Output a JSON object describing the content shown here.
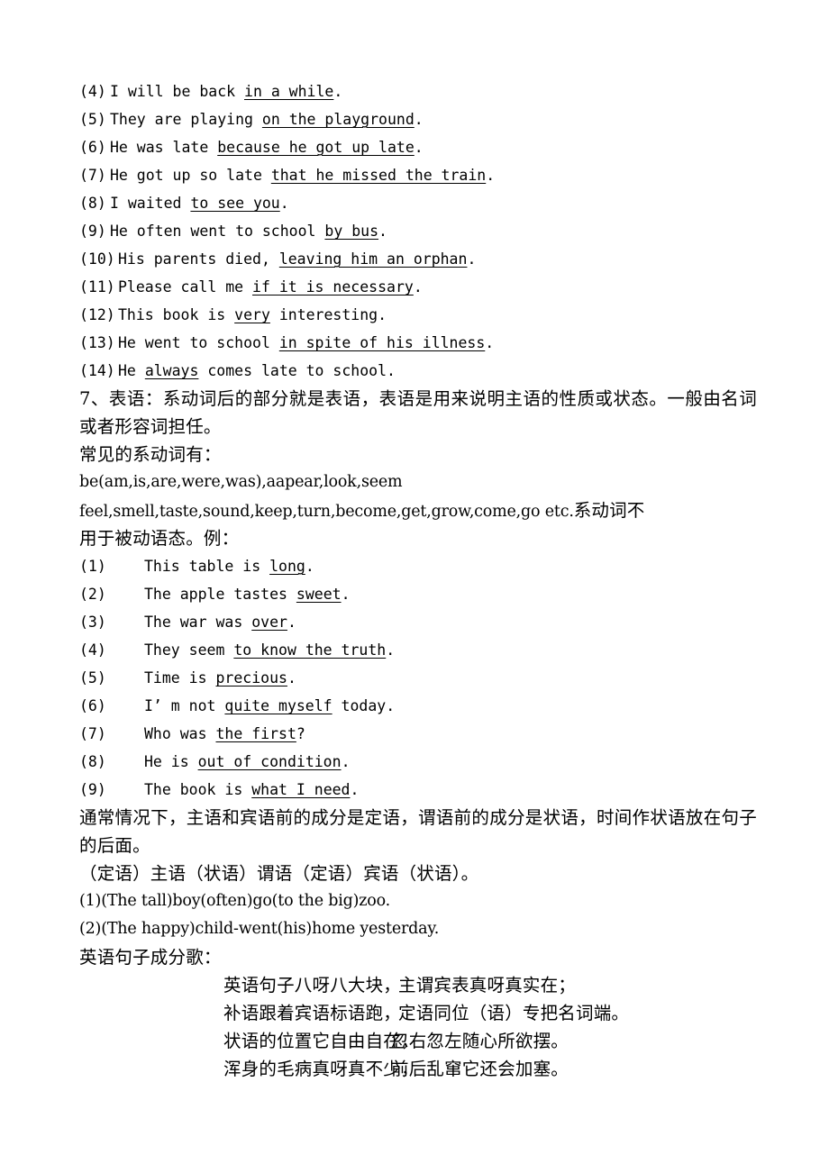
{
  "document": {
    "adverbial_examples": [
      {
        "num": "(4)",
        "width": "w3",
        "pre": "I will be back ",
        "underlined": "in a while",
        "post": "."
      },
      {
        "num": "(5)",
        "width": "w3",
        "pre": "They are playing ",
        "underlined": "on the playground",
        "post": "."
      },
      {
        "num": "(6)",
        "width": "w3",
        "pre": "He was late ",
        "underlined": "because he got up late",
        "post": "."
      },
      {
        "num": "(7)",
        "width": "w3",
        "pre": "He got up so late ",
        "underlined": "that he missed the train",
        "post": "."
      },
      {
        "num": "(8)",
        "width": "w3",
        "pre": "I waited ",
        "underlined": "to see you",
        "post": "."
      },
      {
        "num": "(9)",
        "width": "w3",
        "pre": "He often went to school ",
        "underlined": "by bus",
        "post": "."
      },
      {
        "num": "(10)",
        "width": "w4",
        "pre": "His parents died, ",
        "underlined": "leaving him an orphan",
        "post": "."
      },
      {
        "num": "(11)",
        "width": "w4",
        "pre": "Please call me ",
        "underlined": "if it is necessary",
        "post": "."
      },
      {
        "num": "(12)",
        "width": "w4",
        "pre": "This book is ",
        "underlined": "very",
        "post": " interesting."
      },
      {
        "num": "(13)",
        "width": "w4",
        "pre": "He went to school ",
        "underlined": "in spite of his illness",
        "post": "."
      },
      {
        "num": "(14)",
        "width": "w4",
        "pre": "He ",
        "underlined": "always",
        "post": " comes late to school."
      }
    ],
    "section_7": {
      "heading_paragraph": "7、表语：系动词后的部分就是表语，表语是用来说明主语的性质或状态。一般由名词或者形容词担任。",
      "common_linking_verbs_label": "常见的系动词有：",
      "linking_verbs_line_1": "be(am,is,are,were,was),aapear,look,seem",
      "linking_verbs_line_2_en": "feel,smell,taste,sound,keep,turn,become,get,grow,come,go etc.",
      "linking_verbs_line_2_cn": "系动词不",
      "linking_verbs_line_3_cn": "用于被动语态。例："
    },
    "predicative_examples": [
      {
        "num": "(1)",
        "pre": "This table is ",
        "underlined": "long",
        "post": "."
      },
      {
        "num": "(2)",
        "pre": "The apple tastes ",
        "underlined": "sweet",
        "post": "."
      },
      {
        "num": "(3)",
        "pre": "The war was ",
        "underlined": "over",
        "post": "."
      },
      {
        "num": "(4)",
        "pre": "They seem ",
        "underlined": "to know the truth",
        "post": "."
      },
      {
        "num": "(5)",
        "pre": "Time is ",
        "underlined": "precious",
        "post": "."
      },
      {
        "num": "(6)",
        "pre": "I’ m not ",
        "underlined": "quite myself",
        "post": " today."
      },
      {
        "num": "(7)",
        "pre": "Who was ",
        "underlined": "the first",
        "post": "?"
      },
      {
        "num": "(8)",
        "pre": "He is ",
        "underlined": "out of condition",
        "post": "."
      },
      {
        "num": "(9)",
        "pre": "The book is ",
        "underlined": "what I need",
        "post": "."
      }
    ],
    "order_rules": {
      "paragraph": "通常情况下，主语和宾语前的成分是定语，谓语前的成分是状语，时间作状语放在句子的后面。",
      "pattern": "（定语）主语（状语）谓语（定语）宾语（状语）。",
      "examples": [
        {
          "num": "(1)",
          "text": "(The tall)boy(often)go(to the big)zoo."
        },
        {
          "num": "(2)",
          "text": "(The happy)child-went(his)home yesterday."
        }
      ]
    },
    "song": {
      "title": "英语句子成分歌：",
      "lines": [
        {
          "first": "英语句子八呀八大块，",
          "second": "主谓宾表真呀真实在；",
          "tight": false
        },
        {
          "first": "补语跟着宾语标语跑，",
          "second": "定语同位（语）专把名词端。",
          "tight": false
        },
        {
          "first": "状语的位置它自由自在，",
          "second": "忽右忽左随心所欲摆。",
          "tight": true
        },
        {
          "first": "浑身的毛病真呀真不少，",
          "second": "前后乱窜它还会加塞。",
          "tight": true
        }
      ]
    }
  }
}
